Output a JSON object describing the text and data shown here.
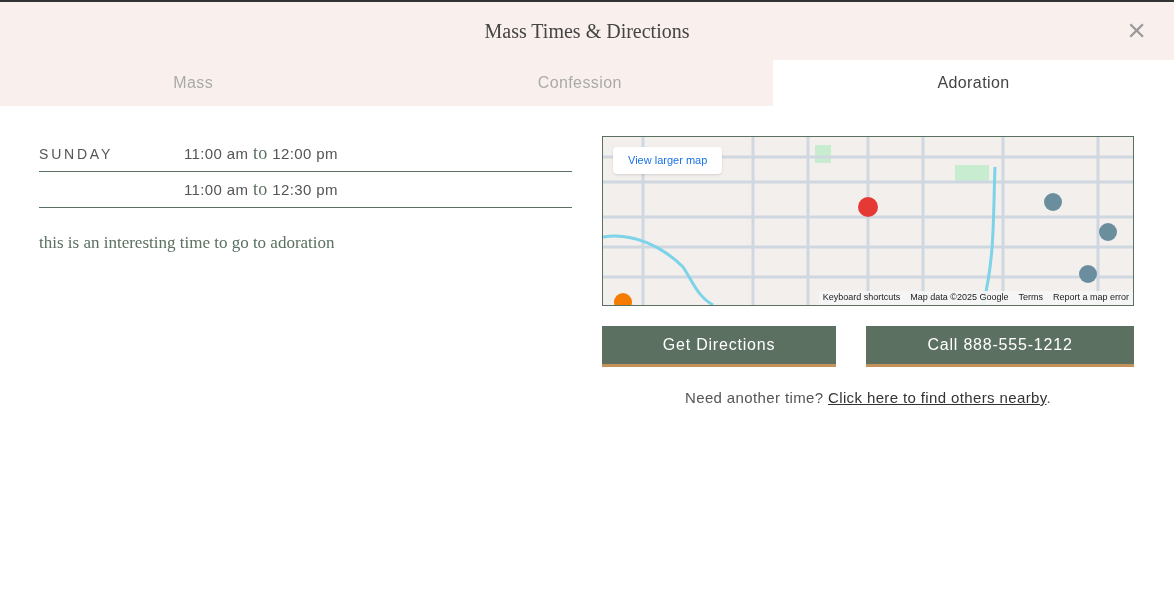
{
  "dialog": {
    "title": "Mass Times & Directions",
    "close": "×"
  },
  "tabs": [
    {
      "label": "Mass",
      "selected": false
    },
    {
      "label": "Confession",
      "selected": false
    },
    {
      "label": "Adoration",
      "selected": true
    }
  ],
  "schedule": [
    {
      "day": "SUNDAY",
      "start": "11:00 am",
      "joiner": "to",
      "end": "12:00 pm"
    },
    {
      "start": "11:00 am",
      "joiner": "to",
      "end": "12:30 pm"
    }
  ],
  "note": "this is an interesting time to go to adoration",
  "map": {
    "kind": "picture",
    "larger_map": "View larger map",
    "footer": [
      "Keyboard shortcuts",
      "Map data ©2025 Google",
      "Terms",
      "Report a map error"
    ]
  },
  "buttons": [
    "Get Directions",
    "Call 888-555-1212"
  ],
  "footer": {
    "text": "Need another time?",
    "link": "Click here to find others nearby",
    "end": "."
  }
}
